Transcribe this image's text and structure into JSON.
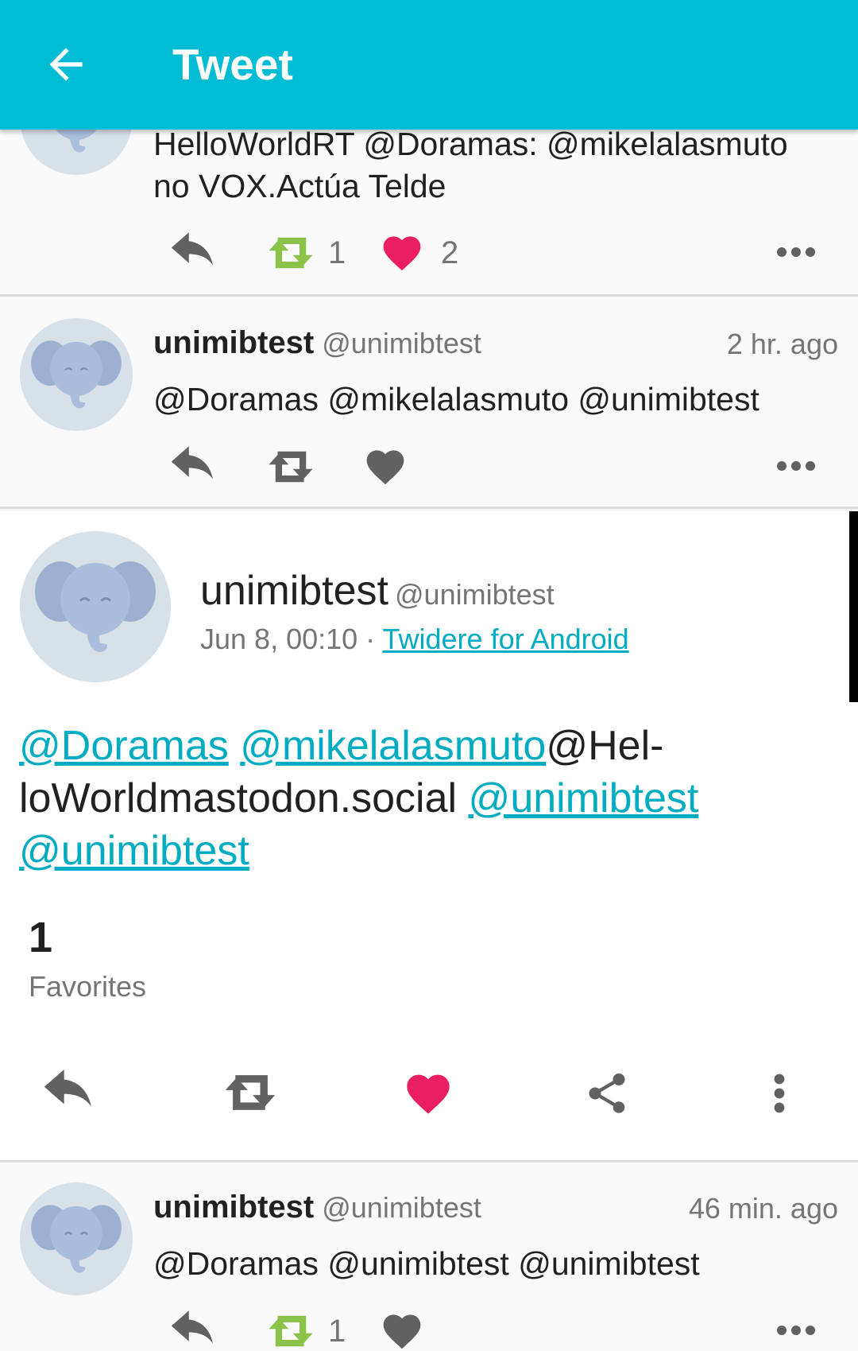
{
  "app_bar": {
    "title": "Tweet",
    "back_icon": "arrow-left-icon"
  },
  "colors": {
    "accent": "#00bcd4",
    "link": "#00acc1",
    "like_active": "#e91e63",
    "retweet_active": "#8bc34a",
    "icon_default": "#616161"
  },
  "tweets": [
    {
      "text_lines": [
        "HelloWorldRT @Doramas: @mikelalasmuto",
        "no VOX.Actúa Telde"
      ],
      "retweet_count": "1",
      "like_count": "2"
    },
    {
      "name": "unimibtest",
      "handle": "@unimibtest",
      "time": "2 hr. ago",
      "text": "@Doramas @mikelalasmuto @unimibtest"
    },
    {
      "name": "unimibtest",
      "handle": "@unimibtest",
      "time": "46 min. ago",
      "text": "@Doramas @unimibtest @unimibtest",
      "retweet_count": "1"
    }
  ],
  "detail": {
    "name": "unimibtest",
    "handle": "@unimibtest",
    "date": "Jun 8, 00:10",
    "separator": " · ",
    "source": "Twidere for Android",
    "body": {
      "mention1": "@Doramas",
      "mention2": "@mikelalasmuto",
      "plain1": "@Hel-",
      "plain2": "loWorldmastodon.social ",
      "mention3": "@unimibtest",
      "mention4": "@unimibtest"
    },
    "favorites_count": "1",
    "favorites_label": "Favorites"
  }
}
